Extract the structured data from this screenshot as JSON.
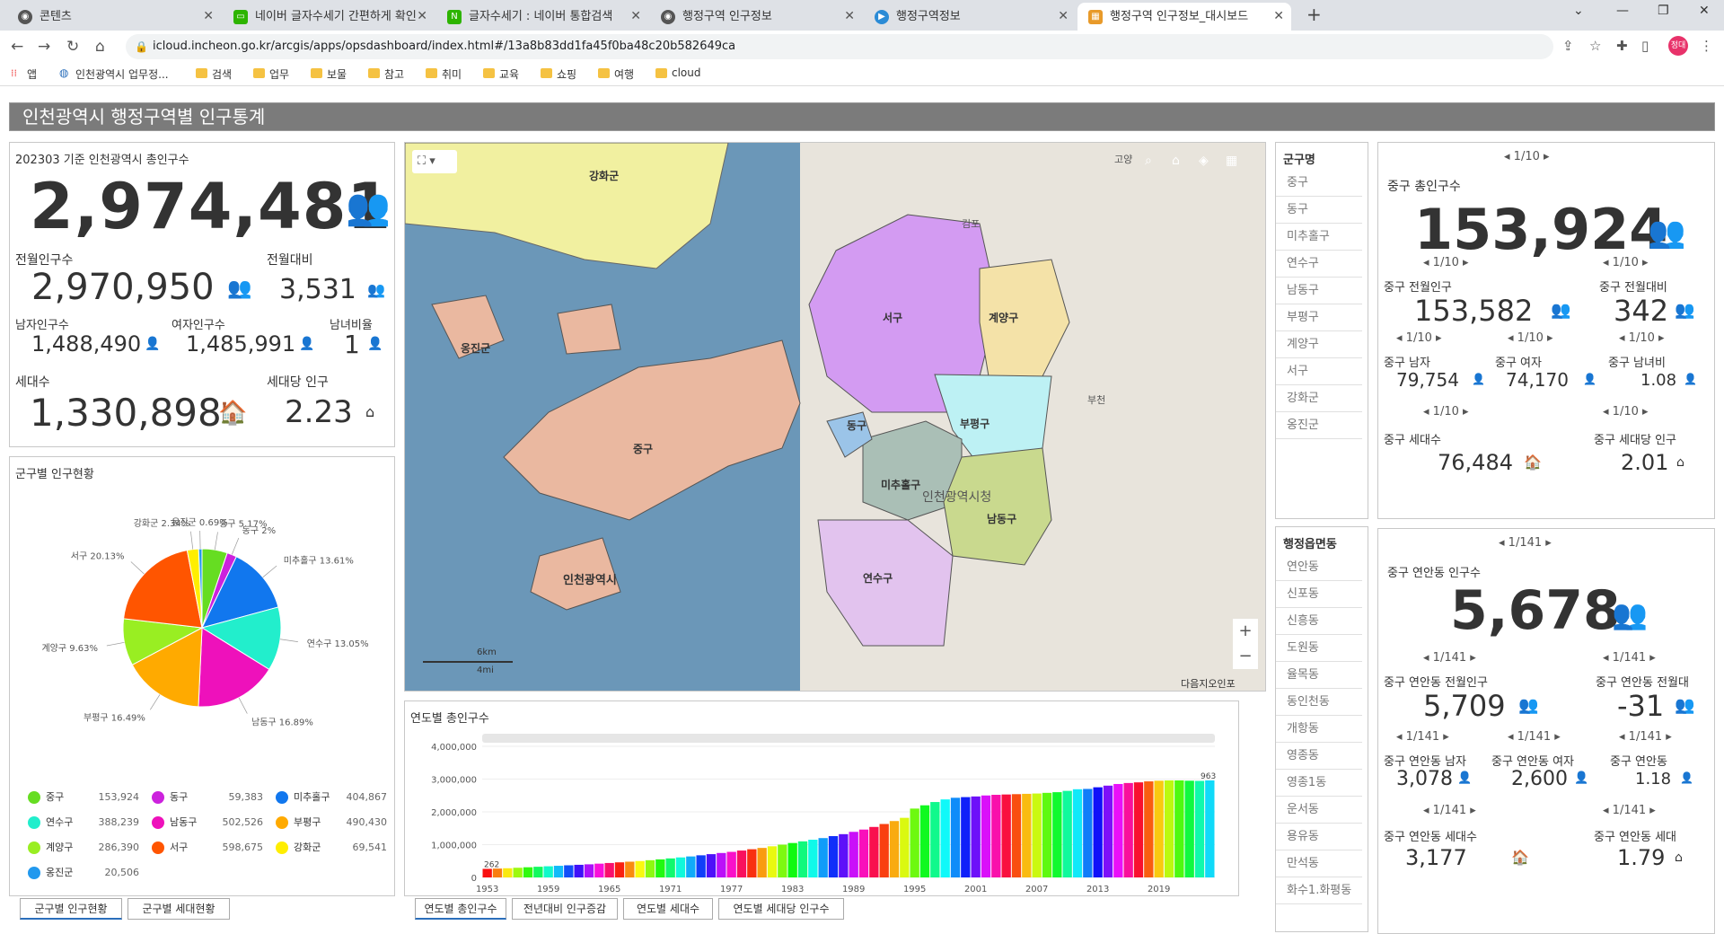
{
  "browser": {
    "tabs": [
      {
        "label": "콘텐츠",
        "color": "#555"
      },
      {
        "label": "네이버 글자수세기 간편하게 확인",
        "color": "#2db400"
      },
      {
        "label": "글자수세기 : 네이버 통합검색",
        "color": "#2db400"
      },
      {
        "label": "행정구역 인구정보",
        "color": "#555"
      },
      {
        "label": "행정구역정보",
        "color": "#2a8bd6"
      },
      {
        "label": "행정구역 인구정보_대시보드",
        "color": "#e89a2a"
      }
    ],
    "url": "icloud.incheon.go.kr/arcgis/apps/opsdashboard/index.html#/13a8b83dd1fa45f0ba48c20b582649ca",
    "avatar": "정대",
    "bookmarks": [
      "앱",
      "인천광역시 업무정...",
      "검색",
      "업무",
      "보물",
      "참고",
      "취미",
      "교육",
      "쇼핑",
      "여행",
      "cloud"
    ]
  },
  "header": {
    "title": "인천광역시 행정구역별 인구통계"
  },
  "total": {
    "title": "202303 기준  인천광역시 총인구수",
    "value": "2,974,481",
    "prev_label": "전월인구수",
    "prev_value": "2,970,950",
    "diff_label": "전월대비",
    "diff_value": "3,531",
    "male_label": "남자인구수",
    "male_value": "1,488,490",
    "female_label": "여자인구수",
    "female_value": "1,485,991",
    "ratio_label": "남녀비율",
    "ratio_value": "1",
    "hh_label": "세대수",
    "hh_value": "1,330,898",
    "perhh_label": "세대당 인구",
    "perhh_value": "2.23"
  },
  "pie": {
    "title": "군구별 인구현황",
    "legend": [
      {
        "name": "중구",
        "value": "153,924",
        "color": "#66dd22"
      },
      {
        "name": "동구",
        "value": "59,383",
        "color": "#cc22dd"
      },
      {
        "name": "미추홀구",
        "value": "404,867",
        "color": "#1177ee"
      },
      {
        "name": "연수구",
        "value": "388,239",
        "color": "#22eecc"
      },
      {
        "name": "남동구",
        "value": "502,526",
        "color": "#ee11bb"
      },
      {
        "name": "부평구",
        "value": "490,430",
        "color": "#ffaa00"
      },
      {
        "name": "계양구",
        "value": "286,390",
        "color": "#99ee22"
      },
      {
        "name": "서구",
        "value": "598,675",
        "color": "#ff5500"
      },
      {
        "name": "강화군",
        "value": "69,541",
        "color": "#ffee00"
      },
      {
        "name": "옹진군",
        "value": "20,506",
        "color": "#2299ee"
      }
    ],
    "slice_labels": [
      "중구 5.17%",
      "동구 2%",
      "미추홀구 13.61%",
      "연수구 13.05%",
      "남동구 16.89%",
      "부평구 16.49%",
      "계양구 9.63%",
      "서구 20.13%",
      "강화군 2.34%",
      "옹진군 0.69%"
    ]
  },
  "chart_data": {
    "type": "bar",
    "title": "연도별 총인구수",
    "xlabel": "",
    "ylabel": "",
    "ylim": [
      0,
      4000000
    ],
    "yticks": [
      "4,000,000",
      "3,000,000",
      "2,000,000",
      "1,000,000",
      "0"
    ],
    "xticks": [
      "1953",
      "1959",
      "1965",
      "1971",
      "1977",
      "1983",
      "1989",
      "1995",
      "2001",
      "2007",
      "2013",
      "2019"
    ],
    "start_year": 1953,
    "values": [
      262000,
      270000,
      280000,
      295000,
      310000,
      325000,
      340000,
      355000,
      370000,
      385000,
      400000,
      420000,
      440000,
      460000,
      480000,
      500000,
      525000,
      550000,
      580000,
      610000,
      640000,
      675000,
      710000,
      745000,
      780000,
      820000,
      860000,
      900000,
      950000,
      1000000,
      1050000,
      1100000,
      1150000,
      1200000,
      1260000,
      1320000,
      1390000,
      1460000,
      1540000,
      1630000,
      1720000,
      1818000,
      2100000,
      2200000,
      2300000,
      2380000,
      2430000,
      2450000,
      2470000,
      2500000,
      2520000,
      2530000,
      2540000,
      2550000,
      2560000,
      2580000,
      2600000,
      2640000,
      2690000,
      2700000,
      2750000,
      2800000,
      2850000,
      2880000,
      2900000,
      2930000,
      2950000,
      2960000,
      2960000,
      2950000,
      2945000,
      2960000
    ],
    "first_label": "262",
    "last_label": "963"
  },
  "map": {
    "labels": [
      "강화군",
      "서구",
      "계양구",
      "부평구",
      "옹진군",
      "중구",
      "동구",
      "미추홀구",
      "남동구",
      "연수구",
      "인천광역시",
      "인천광역시청",
      "김포",
      "고양",
      "부천"
    ],
    "scale_km": "6km",
    "scale_mi": "4mi",
    "attribution": "다음지오인포"
  },
  "district_list": {
    "title": "군구명",
    "items": [
      "중구",
      "동구",
      "미추홀구",
      "연수구",
      "남동구",
      "부평구",
      "계양구",
      "서구",
      "강화군",
      "옹진군"
    ]
  },
  "dong_list": {
    "title": "행정읍면동",
    "items": [
      "연안동",
      "신포동",
      "신흥동",
      "도원동",
      "율목동",
      "동인천동",
      "개항동",
      "영종동",
      "영종1동",
      "운서동",
      "용유동",
      "만석동",
      "화수1.화평동"
    ]
  },
  "gu": {
    "pager": "1/10",
    "title": "중구 총인구수",
    "value": "153,924",
    "prev_label": "중구 전월인구",
    "prev_value": "153,582",
    "diff_label": "중구 전월대비",
    "diff_value": "342",
    "male_label": "중구 남자",
    "male_value": "79,754",
    "female_label": "중구 여자",
    "female_value": "74,170",
    "ratio_label": "중구 남녀비",
    "ratio_value": "1.08",
    "hh_label": "중구 세대수",
    "hh_value": "76,484",
    "perhh_label": "중구 세대당 인구",
    "perhh_value": "2.01"
  },
  "dong": {
    "pager": "1/141",
    "title": "중구 연안동 인구수",
    "value": "5,678",
    "prev_label": "중구 연안동 전월인구",
    "prev_value": "5,709",
    "diff_label": "중구 연안동 전월대",
    "diff_value": "-31",
    "male_label": "중구 연안동 남자",
    "male_value": "3,078",
    "female_label": "중구 연안동 여자",
    "female_value": "2,600",
    "ratio_label": "중구 연안동",
    "ratio_value": "1.18",
    "hh_label": "중구 연안동 세대수",
    "hh_value": "3,177",
    "perhh_label": "중구 연안동 세대",
    "perhh_value": "1.79"
  },
  "bottom_tabs_left": [
    "군구별 인구현황",
    "군구별 세대현황"
  ],
  "bottom_tabs_mid": [
    "연도별 총인구수",
    "전년대비 인구증감",
    "연도별 세대수",
    "연도별 세대당 인구수"
  ]
}
